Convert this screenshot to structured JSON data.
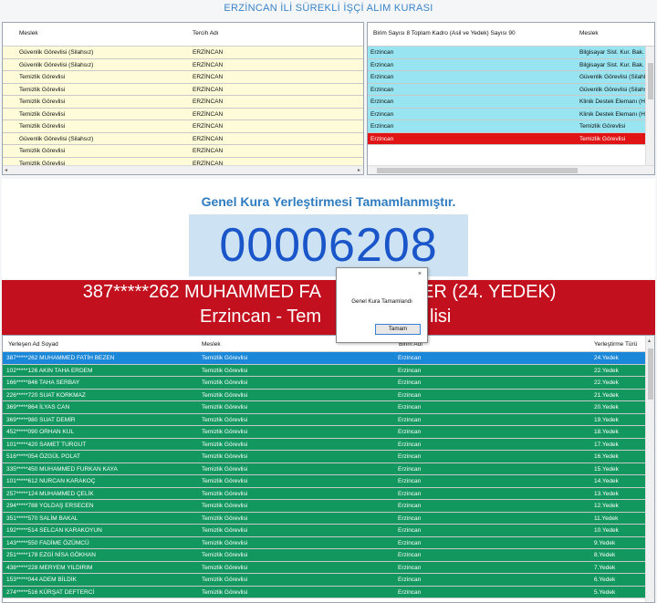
{
  "title": "ERZİNCAN İLİ SÜREKLİ İŞÇİ ALIM KURASI",
  "left_grid": {
    "headers": {
      "meslek": "Meslek",
      "tercih": "Tercih Adı"
    },
    "rows": [
      {
        "meslek": "Güvenlik Görevlisi (Silahsız)",
        "tercih": "ERZİNCAN"
      },
      {
        "meslek": "Güvenlik Görevlisi (Silahsız)",
        "tercih": "ERZİNCAN"
      },
      {
        "meslek": "Temizlik Görevlisi",
        "tercih": "ERZİNCAN"
      },
      {
        "meslek": "Temizlik Görevlisi",
        "tercih": "ERZİNCAN"
      },
      {
        "meslek": "Temizlik Görevlisi",
        "tercih": "ERZİNCAN"
      },
      {
        "meslek": "Temizlik Görevlisi",
        "tercih": "ERZİNCAN"
      },
      {
        "meslek": "Temizlik Görevlisi",
        "tercih": "ERZİNCAN"
      },
      {
        "meslek": "Güvenlik Görevlisi (Silahsız)",
        "tercih": "ERZİNCAN"
      },
      {
        "meslek": "Temizlik Görevlisi",
        "tercih": "ERZİNCAN"
      },
      {
        "meslek": "Temizlik Görevlisi",
        "tercih": "ERZİNCAN"
      }
    ]
  },
  "right_grid": {
    "headers": {
      "birim": "Birim Sayısı 8 Toplam Kadro (Asil ve Yedek) Sayısı 90",
      "meslek": "Meslek"
    },
    "rows": [
      {
        "birim": "Erzincan",
        "meslek": "Bilgisayar Sist. Kur. Bak. On. ve"
      },
      {
        "birim": "Erzincan",
        "meslek": "Bilgisayar Sist. Kur. Bak. On. ve"
      },
      {
        "birim": "Erzincan",
        "meslek": "Güvenlik Görevlisi (Silahlı)"
      },
      {
        "birim": "Erzincan",
        "meslek": "Güvenlik Görevlisi (Silahsız)"
      },
      {
        "birim": "Erzincan",
        "meslek": "Klinik Destek Elemanı (Hastane"
      },
      {
        "birim": "Erzincan",
        "meslek": "Klinik Destek Elemanı (Hastane"
      },
      {
        "birim": "Erzincan",
        "meslek": "Temizlik Görevlisi"
      },
      {
        "birim": "Erzincan",
        "meslek": "Temizlik Görevlisi"
      }
    ]
  },
  "headline": "Genel Kura Yerleştirmesi Tamamlanmıştır.",
  "number": "00006208",
  "winner_line1": "387*****262 MUHAMMED FA",
  "winner_line1_end": "ER (24. YEDEK)",
  "winner_line2": "Erzincan - Tem",
  "winner_line2_end": "lisi",
  "dialog": {
    "close": "×",
    "message": "Genel Kura Tamamlandı",
    "button": "Tamam"
  },
  "bottom_grid": {
    "headers": {
      "ad": "Yerleşen Ad Soyad",
      "meslek": "Meslek",
      "birim": "Birim Adı",
      "tur": "Yerleştirme Türü"
    },
    "rows": [
      {
        "ad": "387*****262 MUHAMMED FATİH BEZEN",
        "meslek": "Temizlik Görevlisi",
        "birim": "Erzincan",
        "tur": "24.Yedek"
      },
      {
        "ad": "102*****126 AKIN TAHA ERDEM",
        "meslek": "Temizlik Görevlisi",
        "birim": "Erzincan",
        "tur": "22.Yedek"
      },
      {
        "ad": "166*****846 TAHA SERBAY",
        "meslek": "Temizlik Görevlisi",
        "birim": "Erzincan",
        "tur": "22.Yedek"
      },
      {
        "ad": "226*****720 SUAT KORKMAZ",
        "meslek": "Temizlik Görevlisi",
        "birim": "Erzincan",
        "tur": "21.Yedek"
      },
      {
        "ad": "369*****864 İLYAS CAN",
        "meslek": "Temizlik Görevlisi",
        "birim": "Erzincan",
        "tur": "20.Yedek"
      },
      {
        "ad": "369*****980 SUAT DEMİR",
        "meslek": "Temizlik Görevlisi",
        "birim": "Erzincan",
        "tur": "19.Yedek"
      },
      {
        "ad": "452*****090 ORHAN KUL",
        "meslek": "Temizlik Görevlisi",
        "birim": "Erzincan",
        "tur": "18.Yedek"
      },
      {
        "ad": "101*****420 SAMET TURGUT",
        "meslek": "Temizlik Görevlisi",
        "birim": "Erzincan",
        "tur": "17.Yedek"
      },
      {
        "ad": "516*****054 ÖZGÜL POLAT",
        "meslek": "Temizlik Görevlisi",
        "birim": "Erzincan",
        "tur": "16.Yedek"
      },
      {
        "ad": "335*****450 MUHAMMED FURKAN KAYA",
        "meslek": "Temizlik Görevlisi",
        "birim": "Erzincan",
        "tur": "15.Yedek"
      },
      {
        "ad": "101*****612 NURCAN KARAKOÇ",
        "meslek": "Temizlik Görevlisi",
        "birim": "Erzincan",
        "tur": "14.Yedek"
      },
      {
        "ad": "257*****124 MUHAMMED ÇELİK",
        "meslek": "Temizlik Görevlisi",
        "birim": "Erzincan",
        "tur": "13.Yedek"
      },
      {
        "ad": "294*****788 YOLDAŞ ERSECEN",
        "meslek": "Temizlik Görevlisi",
        "birim": "Erzincan",
        "tur": "12.Yedek"
      },
      {
        "ad": "351*****570 SALİM BAKAL",
        "meslek": "Temizlik Görevlisi",
        "birim": "Erzincan",
        "tur": "11.Yedek"
      },
      {
        "ad": "192*****514 SELCAN KARAKOYUN",
        "meslek": "Temizlik Görevlisi",
        "birim": "Erzincan",
        "tur": "10.Yedek"
      },
      {
        "ad": "143*****550 FADİME ÖZÜMCÜ",
        "meslek": "Temizlik Görevlisi",
        "birim": "Erzincan",
        "tur": "9.Yedek"
      },
      {
        "ad": "251*****178 EZGİ NİSA GÖKHAN",
        "meslek": "Temizlik Görevlisi",
        "birim": "Erzincan",
        "tur": "8.Yedek"
      },
      {
        "ad": "438*****228 MERYEM YILDIRIM",
        "meslek": "Temizlik Görevlisi",
        "birim": "Erzincan",
        "tur": "7.Yedek"
      },
      {
        "ad": "153*****044 ADEM BİLDİK",
        "meslek": "Temizlik Görevlisi",
        "birim": "Erzincan",
        "tur": "6.Yedek"
      },
      {
        "ad": "274*****516 KÜRŞAT DEFTERCİ",
        "meslek": "Temizlik Görevlisi",
        "birim": "Erzincan",
        "tur": "5.Yedek"
      }
    ]
  },
  "colors": {
    "selected": "#1a87d9",
    "row_green": "#12975e",
    "red": "#c2101e",
    "number": "#1a56c9"
  }
}
